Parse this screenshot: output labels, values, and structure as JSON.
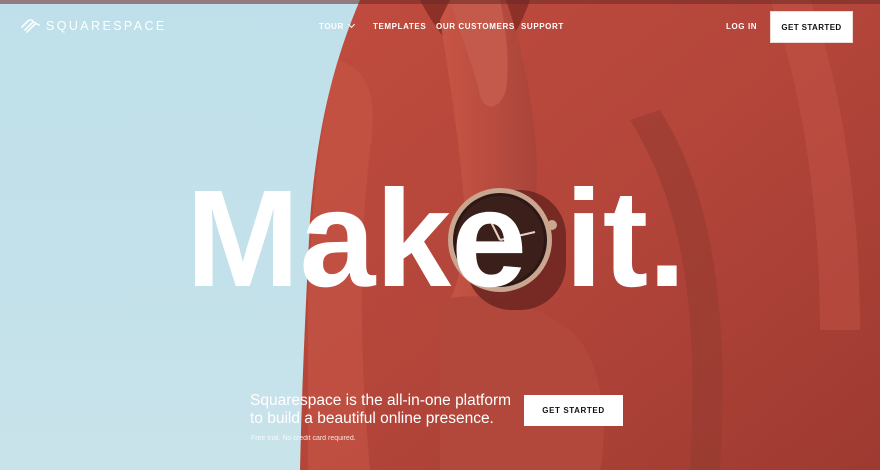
{
  "nav": {
    "brand": "SQUARESPACE",
    "links": [
      {
        "label": "TOUR"
      },
      {
        "label": "TEMPLATES"
      },
      {
        "label": "OUR CUSTOMERS"
      },
      {
        "label": "SUPPORT"
      }
    ],
    "login": "LOG IN",
    "get_started": "GET STARTED"
  },
  "hero": {
    "headline": "Make it.",
    "copy_line1": "Squarespace is the all-in-one platform",
    "copy_line2": "to build a beautiful online presence.",
    "fine_print": "Free trial. No credit card required.",
    "cta": "GET STARTED"
  },
  "colors": {
    "sky": "#bfe0ea",
    "sweater": "#b8473a",
    "text": "#ffffff",
    "button_bg": "#ffffff",
    "button_text": "#111111"
  },
  "icons": {
    "logo": "squarespace-logo-icon",
    "tour_menu": "chevron-down-icon",
    "watch": "wristwatch"
  }
}
